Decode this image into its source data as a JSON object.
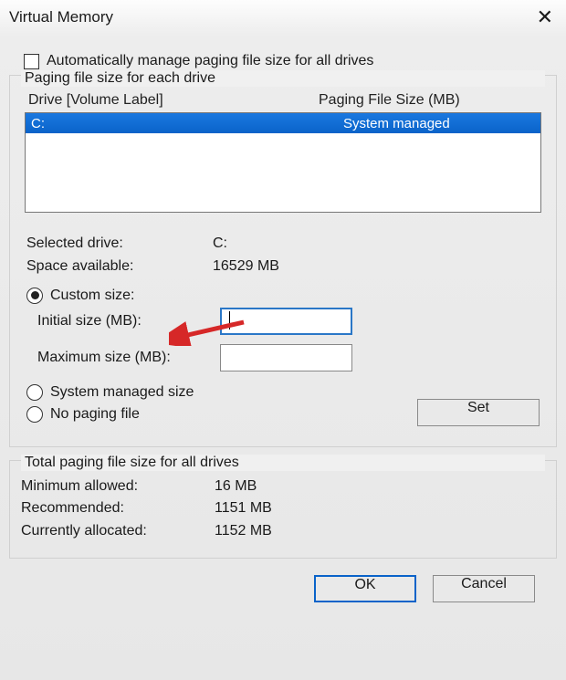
{
  "title": "Virtual Memory",
  "auto_label": "Automatically manage paging file size for all drives",
  "auto_checked": false,
  "section_drives": "Paging file size for each drive",
  "drive_header_col1": "Drive  [Volume Label]",
  "drive_header_col2": "Paging File Size (MB)",
  "drives": [
    {
      "letter": "C:",
      "size_label": "System managed",
      "selected": true
    }
  ],
  "selected_drive_label": "Selected drive:",
  "selected_drive_value": "C:",
  "space_avail_label": "Space available:",
  "space_avail_value": "16529 MB",
  "radio_custom": "Custom size:",
  "radio_system": "System managed size",
  "radio_none": "No paging file",
  "radio_selected": "custom",
  "initial_label": "Initial size (MB):",
  "initial_value": "",
  "max_label": "Maximum size (MB):",
  "max_value": "",
  "set_label": "Set",
  "section_totals": "Total paging file size for all drives",
  "min_label": "Minimum allowed:",
  "min_value": "16 MB",
  "rec_label": "Recommended:",
  "rec_value": "1151 MB",
  "cur_label": "Currently allocated:",
  "cur_value": "1152 MB",
  "ok_label": "OK",
  "cancel_label": "Cancel"
}
